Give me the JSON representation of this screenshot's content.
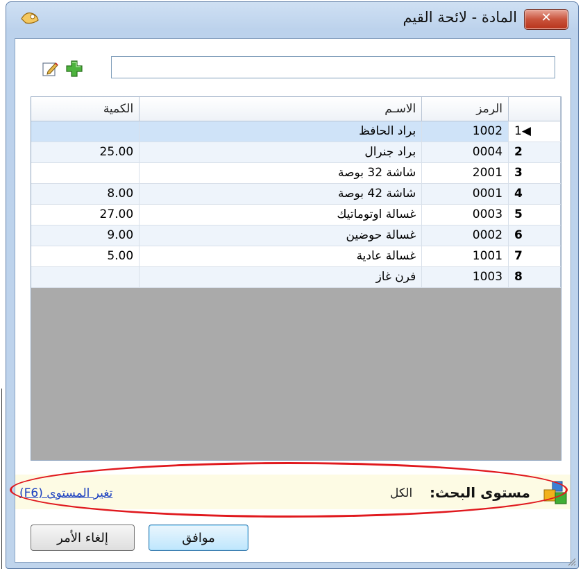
{
  "window": {
    "title": "المادة - لائحة القيم",
    "close_label": "✕"
  },
  "toolbar": {
    "search_value": ""
  },
  "grid": {
    "columns": {
      "code": "الرمز",
      "name": "الاسـم",
      "qty": "الكمية"
    },
    "rows": [
      {
        "num": "1",
        "code": "1002",
        "name": "براد الحافظ",
        "qty": ""
      },
      {
        "num": "2",
        "code": "0004",
        "name": "براد جنرال",
        "qty": "25.00"
      },
      {
        "num": "3",
        "code": "2001",
        "name": "شاشة 32 بوصة",
        "qty": ""
      },
      {
        "num": "4",
        "code": "0001",
        "name": "شاشة 42 بوصة",
        "qty": "8.00"
      },
      {
        "num": "5",
        "code": "0003",
        "name": "غسالة اوتوماتيك",
        "qty": "27.00"
      },
      {
        "num": "6",
        "code": "0002",
        "name": "غسالة حوضين",
        "qty": "9.00"
      },
      {
        "num": "7",
        "code": "1001",
        "name": "غسالة عادية",
        "qty": "5.00"
      },
      {
        "num": "8",
        "code": "1003",
        "name": "فرن غاز",
        "qty": ""
      }
    ],
    "selected_marker": "◀"
  },
  "search": {
    "level_label": "مستوى البحث:",
    "level_value": "الكل",
    "change_link": "تغير المستوى (F6)"
  },
  "buttons": {
    "ok": "موافق",
    "cancel": "إلغاء الأمر"
  },
  "colors": {
    "accent": "#e0191e",
    "selection": "#cfe3f8",
    "link": "#1a3fc0"
  }
}
